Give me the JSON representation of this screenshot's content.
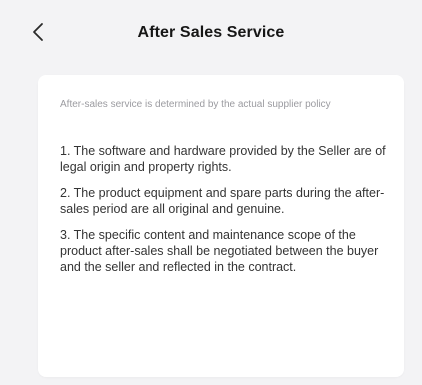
{
  "header": {
    "back_icon": "chevron-left-icon",
    "title": "After Sales Service"
  },
  "card": {
    "policy_note": "After-sales service is determined by the actual supplier policy",
    "terms": [
      "1. The software and hardware provided by the Seller are of legal origin and property rights.",
      "2. The product equipment and spare parts during the after-sales period are all original and genuine.",
      "3. The specific content and maintenance scope of the product after-sales shall be negotiated between the buyer and the seller and reflected in the contract."
    ]
  },
  "colors": {
    "page_background": "#f3f3f5",
    "card_background": "#ffffff",
    "title_text": "#161616",
    "body_text": "#343434",
    "muted_text": "#9b9ba0"
  }
}
